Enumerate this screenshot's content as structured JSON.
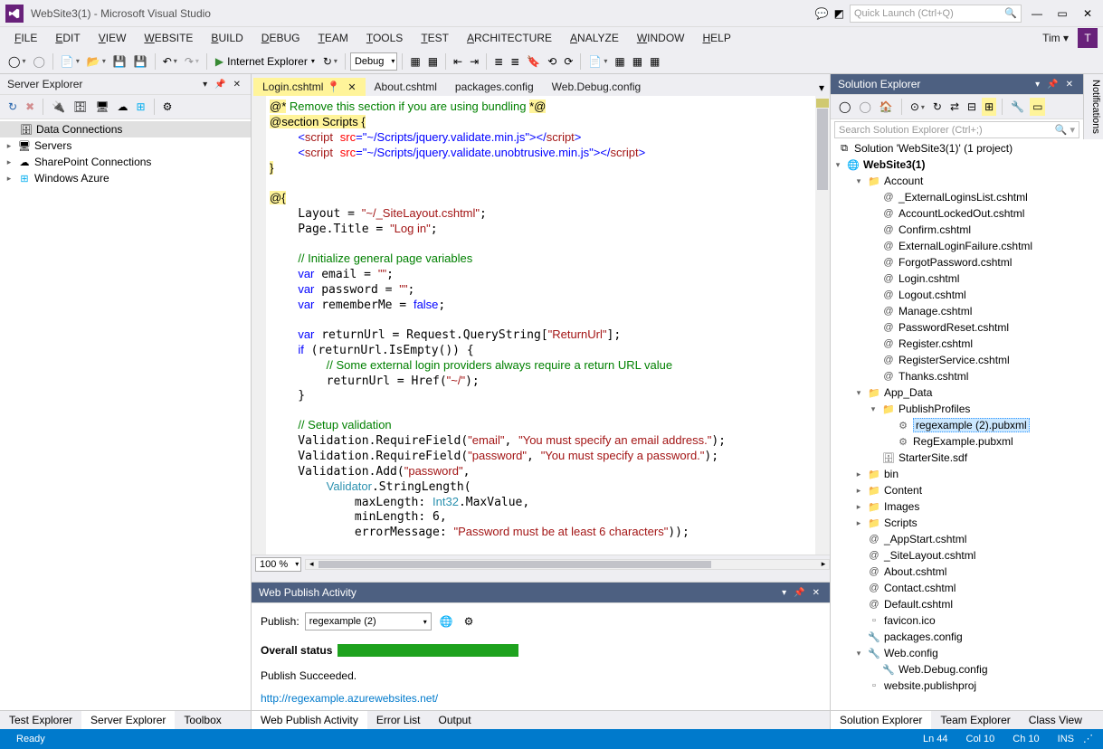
{
  "window": {
    "title": "WebSite3(1) - Microsoft Visual Studio"
  },
  "quickLaunch": {
    "placeholder": "Quick Launch (Ctrl+Q)"
  },
  "user": {
    "name": "Tim",
    "initial": "T"
  },
  "menu": [
    "FILE",
    "EDIT",
    "VIEW",
    "WEBSITE",
    "BUILD",
    "DEBUG",
    "TEAM",
    "TOOLS",
    "TEST",
    "ARCHITECTURE",
    "ANALYZE",
    "WINDOW",
    "HELP"
  ],
  "toolbar": {
    "browser": "Internet Explorer",
    "config": "Debug"
  },
  "serverExplorer": {
    "title": "Server Explorer",
    "items": [
      "Data Connections",
      "Servers",
      "SharePoint Connections",
      "Windows Azure"
    ]
  },
  "leftBottomTabs": [
    "Test Explorer",
    "Server Explorer",
    "Toolbox"
  ],
  "editorTabs": [
    {
      "label": "Login.cshtml",
      "active": true,
      "pinned": true
    },
    {
      "label": "About.cshtml"
    },
    {
      "label": "packages.config"
    },
    {
      "label": "Web.Debug.config"
    }
  ],
  "zoom": "100 %",
  "codeLines": [
    {
      "t": "raw",
      "html": "<span class='at'>@*</span><span class='c'> Remove this section if you are using bundling </span><span class='at'>*@</span>"
    },
    {
      "t": "raw",
      "html": "<span class='at'>@section</span><span class='ye'> Scripts </span><span class='ye'>{</span>"
    },
    {
      "t": "raw",
      "html": "    <span class='kw'>&lt;</span><span class='tag'>script</span> <span class='attr'>src</span><span class='kw'>=\"~/Scripts/jquery.validate.min.js\"&gt;&lt;/</span><span class='tag'>script</span><span class='kw'>&gt;</span>"
    },
    {
      "t": "raw",
      "html": "    <span class='kw'>&lt;</span><span class='tag'>script</span> <span class='attr'>src</span><span class='kw'>=\"~/Scripts/jquery.validate.unobtrusive.min.js\"&gt;&lt;/</span><span class='tag'>script</span><span class='kw'>&gt;</span>"
    },
    {
      "t": "raw",
      "html": "<span class='ye'>}</span>"
    },
    {
      "t": "raw",
      "html": ""
    },
    {
      "t": "raw",
      "html": "<span class='at'>@</span><span class='ye'>{</span>"
    },
    {
      "t": "raw",
      "html": "    Layout = <span class='str'>\"~/_SiteLayout.cshtml\"</span>;"
    },
    {
      "t": "raw",
      "html": "    Page.Title = <span class='str'>\"Log in\"</span>;"
    },
    {
      "t": "raw",
      "html": ""
    },
    {
      "t": "raw",
      "html": "    <span class='c'>// Initialize general page variables</span>"
    },
    {
      "t": "raw",
      "html": "    <span class='kw'>var</span> email = <span class='str'>\"\"</span>;"
    },
    {
      "t": "raw",
      "html": "    <span class='kw'>var</span> password = <span class='str'>\"\"</span>;"
    },
    {
      "t": "raw",
      "html": "    <span class='kw'>var</span> rememberMe = <span class='kw'>false</span>;"
    },
    {
      "t": "raw",
      "html": ""
    },
    {
      "t": "raw",
      "html": "    <span class='kw'>var</span> returnUrl = Request.QueryString[<span class='str'>\"ReturnUrl\"</span>];"
    },
    {
      "t": "raw",
      "html": "    <span class='kw'>if</span> (returnUrl.IsEmpty()) {"
    },
    {
      "t": "raw",
      "html": "        <span class='c'>// Some external login providers always require a return URL value</span>"
    },
    {
      "t": "raw",
      "html": "        returnUrl = Href(<span class='str'>\"~/\"</span>);"
    },
    {
      "t": "raw",
      "html": "    }"
    },
    {
      "t": "raw",
      "html": ""
    },
    {
      "t": "raw",
      "html": "    <span class='c'>// Setup validation</span>"
    },
    {
      "t": "raw",
      "html": "    Validation.RequireField(<span class='str'>\"email\"</span>, <span class='str'>\"You must specify an email address.\"</span>);"
    },
    {
      "t": "raw",
      "html": "    Validation.RequireField(<span class='str'>\"password\"</span>, <span class='str'>\"You must specify a password.\"</span>);"
    },
    {
      "t": "raw",
      "html": "    Validation.Add(<span class='str'>\"password\"</span>,"
    },
    {
      "t": "raw",
      "html": "        <span class='t'>Validator</span>.StringLength("
    },
    {
      "t": "raw",
      "html": "            maxLength: <span class='t'>Int32</span>.MaxValue,"
    },
    {
      "t": "raw",
      "html": "            minLength: 6,"
    },
    {
      "t": "raw",
      "html": "            errorMessage: <span class='str'>\"Password must be at least 6 characters\"</span>));"
    }
  ],
  "webPublish": {
    "title": "Web Publish Activity",
    "publishLabel": "Publish:",
    "profile": "regexample (2)",
    "overallLabel": "Overall status",
    "succeeded": "Publish Succeeded.",
    "link": "http://regexample.azurewebsites.net/"
  },
  "centerBottomTabs": [
    "Web Publish Activity",
    "Error List",
    "Output"
  ],
  "solutionExplorer": {
    "title": "Solution Explorer",
    "searchPlaceholder": "Search Solution Explorer (Ctrl+;)",
    "solution": "Solution 'WebSite3(1)' (1 project)",
    "project": "WebSite3(1)",
    "tree": [
      {
        "d": 1,
        "exp": "▾",
        "icon": "folder",
        "label": "Account"
      },
      {
        "d": 2,
        "icon": "cs",
        "label": "_ExternalLoginsList.cshtml"
      },
      {
        "d": 2,
        "icon": "cs",
        "label": "AccountLockedOut.cshtml"
      },
      {
        "d": 2,
        "icon": "cs",
        "label": "Confirm.cshtml"
      },
      {
        "d": 2,
        "icon": "cs",
        "label": "ExternalLoginFailure.cshtml"
      },
      {
        "d": 2,
        "icon": "cs",
        "label": "ForgotPassword.cshtml"
      },
      {
        "d": 2,
        "icon": "cs",
        "label": "Login.cshtml"
      },
      {
        "d": 2,
        "icon": "cs",
        "label": "Logout.cshtml"
      },
      {
        "d": 2,
        "icon": "cs",
        "label": "Manage.cshtml"
      },
      {
        "d": 2,
        "icon": "cs",
        "label": "PasswordReset.cshtml"
      },
      {
        "d": 2,
        "icon": "cs",
        "label": "Register.cshtml"
      },
      {
        "d": 2,
        "icon": "cs",
        "label": "RegisterService.cshtml"
      },
      {
        "d": 2,
        "icon": "cs",
        "label": "Thanks.cshtml"
      },
      {
        "d": 1,
        "exp": "▾",
        "icon": "folder",
        "label": "App_Data"
      },
      {
        "d": 2,
        "exp": "▾",
        "icon": "folder",
        "label": "PublishProfiles"
      },
      {
        "d": 3,
        "icon": "pub",
        "label": "regexample (2).pubxml",
        "selected": true
      },
      {
        "d": 3,
        "icon": "pub",
        "label": "RegExample.pubxml"
      },
      {
        "d": 2,
        "icon": "db",
        "label": "StarterSite.sdf"
      },
      {
        "d": 1,
        "exp": "▸",
        "icon": "folder",
        "label": "bin"
      },
      {
        "d": 1,
        "exp": "▸",
        "icon": "folder",
        "label": "Content"
      },
      {
        "d": 1,
        "exp": "▸",
        "icon": "folder",
        "label": "Images"
      },
      {
        "d": 1,
        "exp": "▸",
        "icon": "folder",
        "label": "Scripts"
      },
      {
        "d": 1,
        "icon": "cs",
        "label": "_AppStart.cshtml"
      },
      {
        "d": 1,
        "icon": "cs",
        "label": "_SiteLayout.cshtml"
      },
      {
        "d": 1,
        "icon": "cs",
        "label": "About.cshtml"
      },
      {
        "d": 1,
        "icon": "cs",
        "label": "Contact.cshtml"
      },
      {
        "d": 1,
        "icon": "cs",
        "label": "Default.cshtml"
      },
      {
        "d": 1,
        "icon": "file",
        "label": "favicon.ico"
      },
      {
        "d": 1,
        "icon": "config",
        "label": "packages.config"
      },
      {
        "d": 1,
        "exp": "▾",
        "icon": "config",
        "label": "Web.config"
      },
      {
        "d": 2,
        "icon": "config",
        "label": "Web.Debug.config"
      },
      {
        "d": 1,
        "icon": "file",
        "label": "website.publishproj"
      }
    ]
  },
  "rightBottomTabs": [
    "Solution Explorer",
    "Team Explorer",
    "Class View"
  ],
  "notificationsTab": "Notifications",
  "statusbar": {
    "ready": "Ready",
    "ln": "Ln 44",
    "col": "Col 10",
    "ch": "Ch 10",
    "ins": "INS"
  }
}
